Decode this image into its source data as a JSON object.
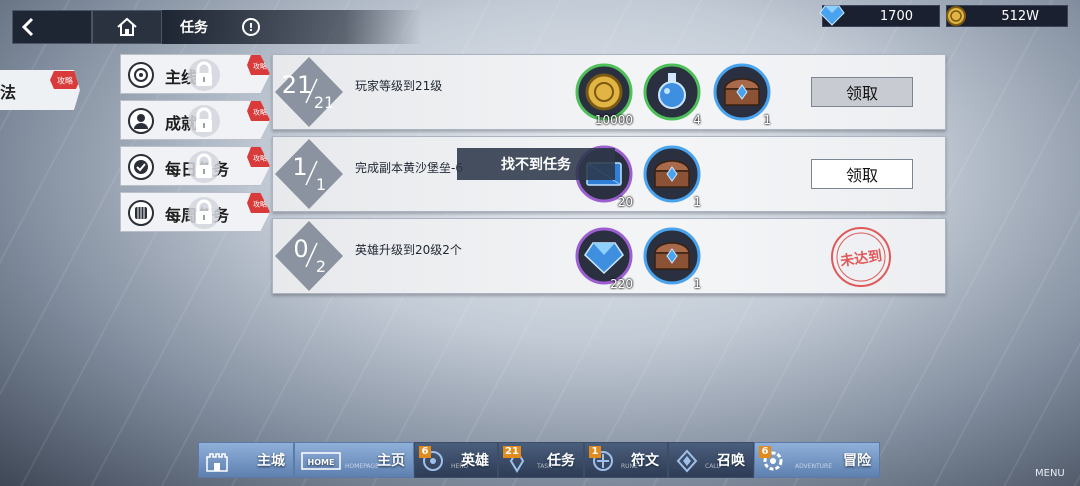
{
  "header": {
    "title": "任务",
    "info_glyph": "!",
    "resources": [
      {
        "icon": "diamond-icon",
        "value": "1700"
      },
      {
        "icon": "gold-coin-icon",
        "value": "512W"
      }
    ]
  },
  "method_tab": {
    "label": "法",
    "badge": "攻略"
  },
  "categories": [
    {
      "label": "主线",
      "badge": "攻略",
      "icon": "mainline-icon"
    },
    {
      "label": "成就",
      "badge": "攻略",
      "icon": "achievement-icon"
    },
    {
      "label": "每日任务",
      "badge": "攻略",
      "icon": "daily-icon"
    },
    {
      "label": "每周任务",
      "badge": "攻略",
      "icon": "weekly-icon"
    }
  ],
  "tasks": [
    {
      "progress_current": "21",
      "progress_total": "21",
      "description": "玩家等级到21级",
      "rewards": [
        {
          "type": "gold-coin",
          "count": "10000"
        },
        {
          "type": "potion",
          "count": "4"
        },
        {
          "type": "chest",
          "count": "1"
        }
      ],
      "action": {
        "kind": "button",
        "label": "领取",
        "state": "disabled"
      }
    },
    {
      "progress_current": "1",
      "progress_total": "1",
      "description": "完成副本黄沙堡垒-6",
      "rewards": [
        {
          "type": "crystal",
          "count": "20"
        },
        {
          "type": "chest",
          "count": "1"
        }
      ],
      "action": {
        "kind": "button",
        "label": "领取",
        "state": "active"
      }
    },
    {
      "progress_current": "0",
      "progress_total": "2",
      "description": "英雄升级到20级2个",
      "rewards": [
        {
          "type": "diamond",
          "count": "220"
        },
        {
          "type": "chest",
          "count": "1"
        }
      ],
      "action": {
        "kind": "stamp",
        "label": "未达到"
      }
    }
  ],
  "toast": "找不到任务",
  "bottom_nav": [
    {
      "label": "主城",
      "sub": "",
      "badge": ""
    },
    {
      "label": "主页",
      "sub": "HOMEPAGE",
      "badge": ""
    },
    {
      "label": "英雄",
      "sub": "HERO",
      "badge": "6"
    },
    {
      "label": "任务",
      "sub": "TASK",
      "badge": "21"
    },
    {
      "label": "符文",
      "sub": "RUNE",
      "badge": "1"
    },
    {
      "label": "召唤",
      "sub": "CALL",
      "badge": ""
    },
    {
      "label": "冒险",
      "sub": "ADVENTURE",
      "badge": "6"
    }
  ],
  "menu_label": "MENU",
  "colors": {
    "accent_blue": "#6f93c6",
    "badge_red": "#d93a3a",
    "nav_badge_orange": "#e28a1c",
    "gold": "#e1b443",
    "gem_blue": "#3f8fe0"
  }
}
